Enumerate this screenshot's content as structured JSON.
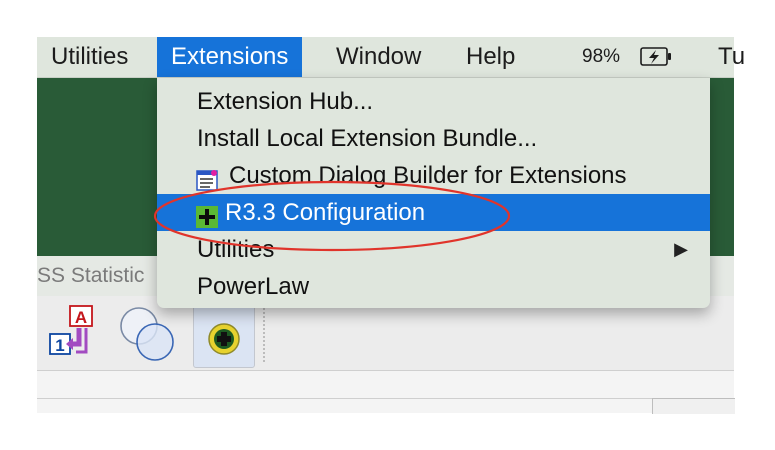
{
  "menubar": {
    "items": [
      {
        "label": "Utilities"
      },
      {
        "label": "Extensions"
      },
      {
        "label": "Window"
      },
      {
        "label": "Help"
      }
    ],
    "battery_percent": "98%",
    "clipped_item": "Tu"
  },
  "window": {
    "title_fragment": "SS Statistic"
  },
  "dropdown": {
    "items": [
      {
        "label": "Extension Hub..."
      },
      {
        "label": "Install Local Extension Bundle..."
      },
      {
        "label": "Custom Dialog Builder for Extensions",
        "icon": "dialog-builder-icon"
      },
      {
        "label": "R3.3 Configuration",
        "icon": "plus-icon",
        "selected": true
      },
      {
        "label": "Utilities",
        "has_submenu": true,
        "submenu_arrow": "▶"
      },
      {
        "label": "PowerLaw"
      }
    ]
  },
  "toolbar": {
    "buttons": [
      {
        "icon": "transform-icon",
        "glyph_top": "A",
        "glyph_bottom": "1"
      },
      {
        "icon": "overlapping-circles-icon"
      },
      {
        "icon": "extension-plus-icon"
      }
    ]
  },
  "colors": {
    "menu_background": "#dfe6dd",
    "selection_blue": "#1673d9",
    "app_green": "#295b37",
    "annotation_red": "#e0342b"
  }
}
